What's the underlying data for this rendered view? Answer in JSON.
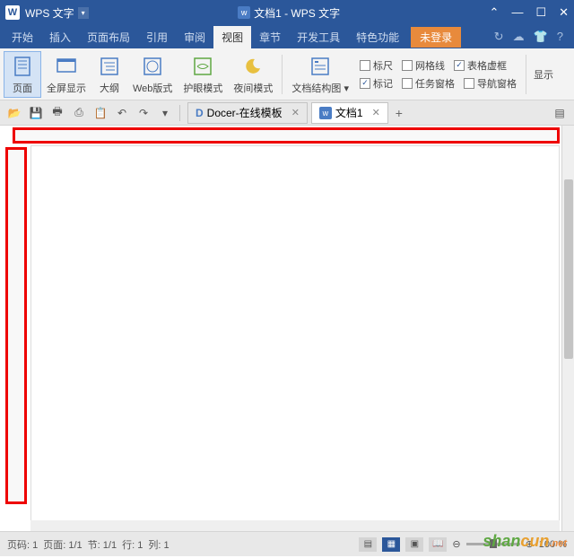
{
  "titlebar": {
    "app_name": "WPS 文字",
    "doc_title": "文档1 - WPS 文字"
  },
  "menu": {
    "items": [
      "开始",
      "插入",
      "页面布局",
      "引用",
      "审阅",
      "视图",
      "章节",
      "开发工具",
      "特色功能"
    ],
    "active_index": 5,
    "login_label": "未登录"
  },
  "ribbon": {
    "view_buttons": [
      {
        "label": "页面",
        "active": true
      },
      {
        "label": "全屏显示"
      },
      {
        "label": "大纲"
      },
      {
        "label": "Web版式"
      },
      {
        "label": "护眼模式"
      },
      {
        "label": "夜间模式"
      }
    ],
    "structure_label": "文档结构图",
    "checkboxes": {
      "ruler": {
        "label": "标尺",
        "checked": false
      },
      "gridlines": {
        "label": "网格线",
        "checked": false
      },
      "table_dashed": {
        "label": "表格虚框",
        "checked": true
      },
      "markup": {
        "label": "标记",
        "checked": true
      },
      "task_pane": {
        "label": "任务窗格",
        "checked": false
      },
      "nav_pane": {
        "label": "导航窗格",
        "checked": false
      }
    },
    "show_label": "显示"
  },
  "tabs": {
    "docer": "Docer-在线模板",
    "doc1": "文档1"
  },
  "status": {
    "page_label": "页码:",
    "page_val": "1",
    "page_of_label": "页面:",
    "page_of_val": "1/1",
    "section_label": "节:",
    "section_val": "1/1",
    "line_label": "行:",
    "line_val": "1",
    "col_label": "列:",
    "col_val": "1",
    "zoom": "100 %"
  },
  "watermark": {
    "text1": "shan",
    "text2": "cun",
    "ext": ".net"
  }
}
